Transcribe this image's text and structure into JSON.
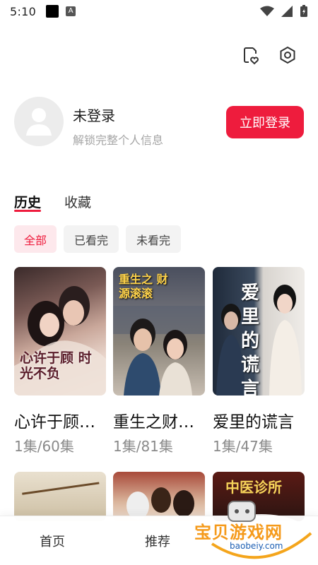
{
  "status": {
    "time": "5:10"
  },
  "profile": {
    "name": "未登录",
    "subtitle": "解锁完整个人信息",
    "login_label": "立即登录"
  },
  "tabs": [
    {
      "label": "历史",
      "active": true
    },
    {
      "label": "收藏",
      "active": false
    }
  ],
  "filters": [
    {
      "label": "全部",
      "active": true
    },
    {
      "label": "已看完",
      "active": false
    },
    {
      "label": "未看完",
      "active": false
    }
  ],
  "items": [
    {
      "title": "心许于顾时光不负",
      "episodes": "1集/60集",
      "cover_text": "心许于顾 时光不负"
    },
    {
      "title": "重生之财源滚滚",
      "episodes": "1集/81集",
      "cover_text": "重生之 财源滚滚"
    },
    {
      "title": "爱里的谎言",
      "episodes": "1集/47集",
      "cover_text": "爱里的谎言"
    }
  ],
  "row2_covers": [
    "",
    "",
    "中医诊所"
  ],
  "nav": [
    {
      "label": "首页"
    },
    {
      "label": "推荐"
    }
  ],
  "watermark": {
    "text": "宝贝游戏网",
    "url": "baobeiy.com"
  },
  "colors": {
    "accent": "#ee1c3d",
    "chip_active_bg": "#fde8ec"
  }
}
